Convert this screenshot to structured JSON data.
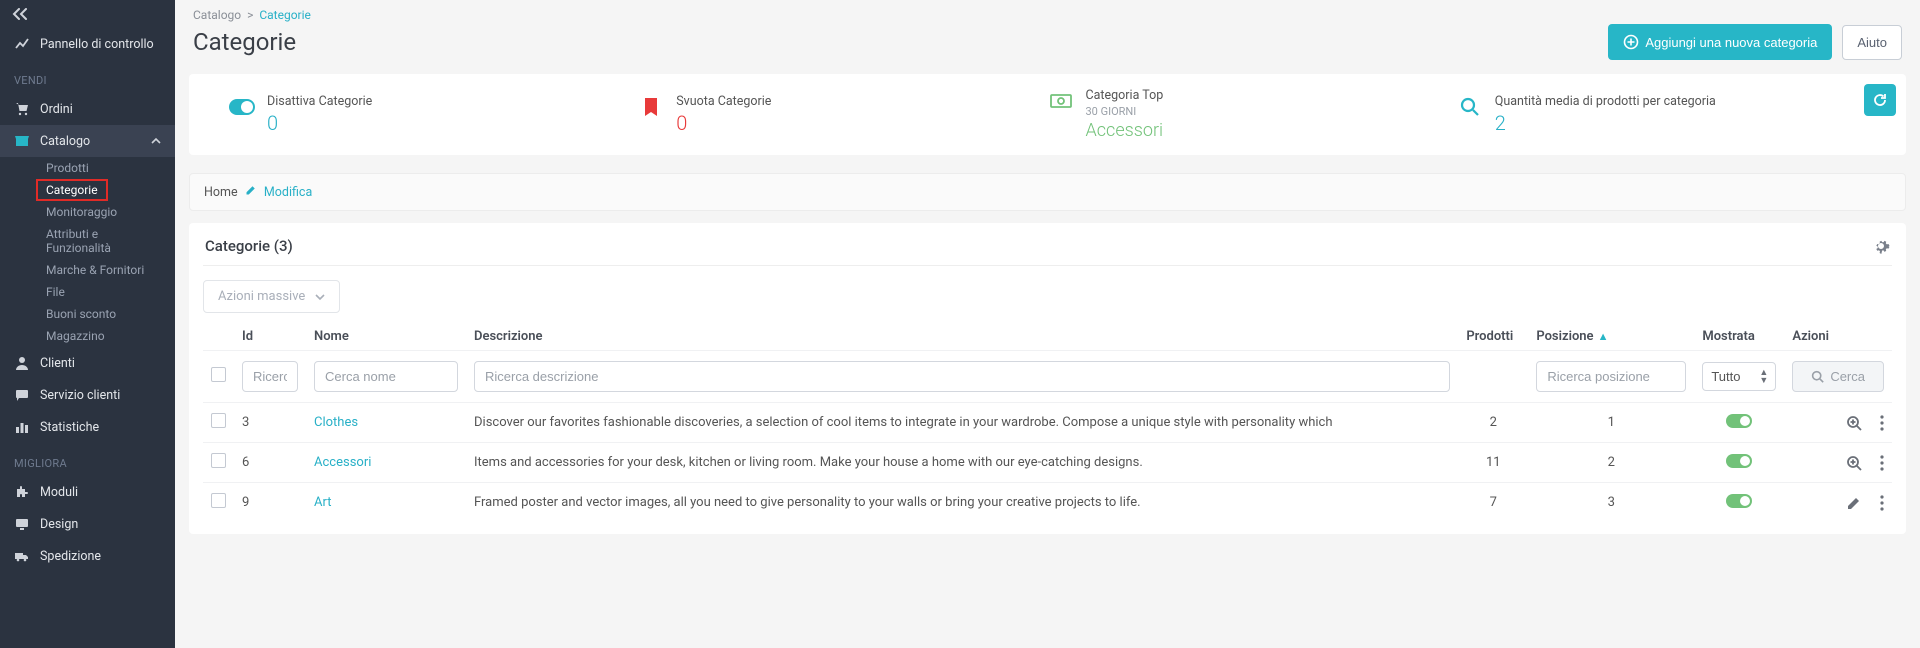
{
  "sidebar": {
    "dashboard": "Pannello di controllo",
    "sections": {
      "sell": "VENDI",
      "improve": "MIGLIORA"
    },
    "items": {
      "orders": "Ordini",
      "catalog": "Catalogo",
      "clients": "Clienti",
      "customerservice": "Servizio clienti",
      "stats": "Statistiche",
      "modules": "Moduli",
      "design": "Design",
      "shipping": "Spedizione"
    },
    "catalog_sub": [
      "Prodotti",
      "Categorie",
      "Monitoraggio",
      "Attributi e Funzionalità",
      "Marche & Fornitori",
      "File",
      "Buoni sconto",
      "Magazzino"
    ]
  },
  "breadcrumb": {
    "root": "Catalogo",
    "sep": ">",
    "current": "Categorie"
  },
  "page": {
    "title": "Categorie"
  },
  "header": {
    "add_btn": "Aggiungi una nuova categoria",
    "help_btn": "Aiuto"
  },
  "stats": {
    "disable": {
      "label": "Disattiva Categorie",
      "value": "0"
    },
    "empty": {
      "label": "Svuota Categorie",
      "value": "0"
    },
    "top": {
      "label": "Categoria Top",
      "sub": "30 GIORNI",
      "value": "Accessori"
    },
    "avg": {
      "label": "Quantità media di prodotti per categoria",
      "value": "2"
    }
  },
  "homebar": {
    "home": "Home",
    "edit": "Modifica"
  },
  "table": {
    "title": "Categorie (3)",
    "bulk": "Azioni massive",
    "cols": {
      "id": "Id",
      "name": "Nome",
      "desc": "Descrizione",
      "products": "Prodotti",
      "position": "Posizione",
      "shown": "Mostrata",
      "actions": "Azioni"
    },
    "search": {
      "id_ph": "Ricerca Id",
      "name_ph": "Cerca nome",
      "desc_ph": "Ricerca descrizione",
      "pos_ph": "Ricerca posizione",
      "shown_opt": "Tutto",
      "btn": "Cerca"
    },
    "rows": [
      {
        "id": "3",
        "name": "Clothes",
        "desc": "Discover our favorites fashionable discoveries, a selection of cool items to integrate in your wardrobe. Compose a unique style with personality which",
        "products": "2",
        "position": "1",
        "action": "zoom"
      },
      {
        "id": "6",
        "name": "Accessori",
        "desc": "Items and accessories for your desk, kitchen or living room. Make your house a home with our eye-catching designs.",
        "products": "11",
        "position": "2",
        "action": "zoom"
      },
      {
        "id": "9",
        "name": "Art",
        "desc": "Framed poster and vector images, all you need to give personality to your walls or bring your creative projects to life.",
        "products": "7",
        "position": "3",
        "action": "edit"
      }
    ]
  }
}
